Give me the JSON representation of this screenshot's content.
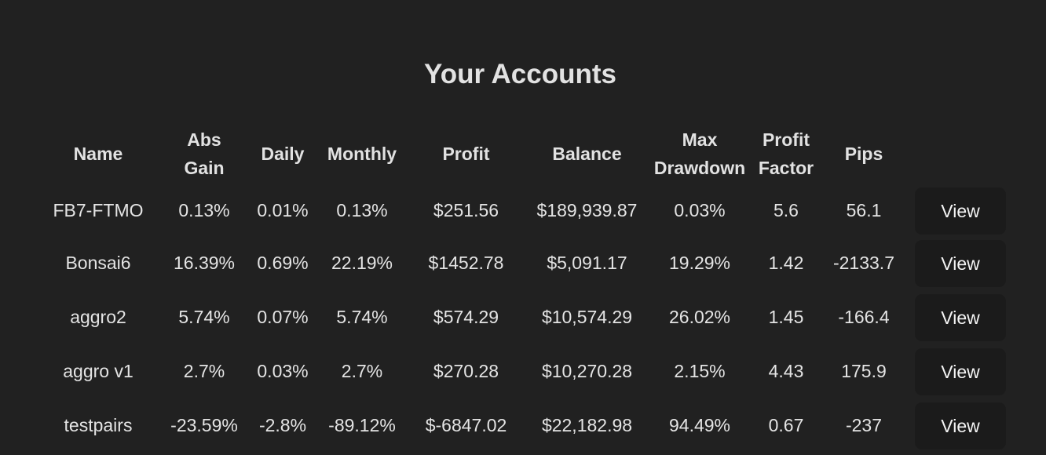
{
  "page": {
    "title": "Your Accounts"
  },
  "table": {
    "headers": {
      "name": "Name",
      "abs_gain": [
        "Abs",
        "Gain"
      ],
      "daily": "Daily",
      "monthly": "Monthly",
      "profit": "Profit",
      "balance": "Balance",
      "max_drawdown": [
        "Max",
        "Drawdown"
      ],
      "profit_factor": [
        "Profit",
        "Factor"
      ],
      "pips": "Pips",
      "action": ""
    },
    "rows": [
      {
        "name": "FB7-FTMO",
        "abs_gain": "0.13%",
        "daily": "0.01%",
        "monthly": "0.13%",
        "profit": "$251.56",
        "balance": "$189,939.87",
        "max_drawdown": "0.03%",
        "profit_factor": "5.6",
        "pips": "56.1",
        "action": "View"
      },
      {
        "name": "Bonsai6",
        "abs_gain": "16.39%",
        "daily": "0.69%",
        "monthly": "22.19%",
        "profit": "$1452.78",
        "balance": "$5,091.17",
        "max_drawdown": "19.29%",
        "profit_factor": "1.42",
        "pips": "-2133.7",
        "action": "View"
      },
      {
        "name": "aggro2",
        "abs_gain": "5.74%",
        "daily": "0.07%",
        "monthly": "5.74%",
        "profit": "$574.29",
        "balance": "$10,574.29",
        "max_drawdown": "26.02%",
        "profit_factor": "1.45",
        "pips": "-166.4",
        "action": "View"
      },
      {
        "name": "aggro v1",
        "abs_gain": "2.7%",
        "daily": "0.03%",
        "monthly": "2.7%",
        "profit": "$270.28",
        "balance": "$10,270.28",
        "max_drawdown": "2.15%",
        "profit_factor": "4.43",
        "pips": "175.9",
        "action": "View"
      },
      {
        "name": "testpairs",
        "abs_gain": "-23.59%",
        "daily": "-2.8%",
        "monthly": "-89.12%",
        "profit": "$-6847.02",
        "balance": "$22,182.98",
        "max_drawdown": "94.49%",
        "profit_factor": "0.67",
        "pips": "-237",
        "action": "View"
      }
    ]
  },
  "colors": {
    "background": "#212121",
    "text": "#e4e4e4",
    "button_bg": "#1b1b1b"
  }
}
